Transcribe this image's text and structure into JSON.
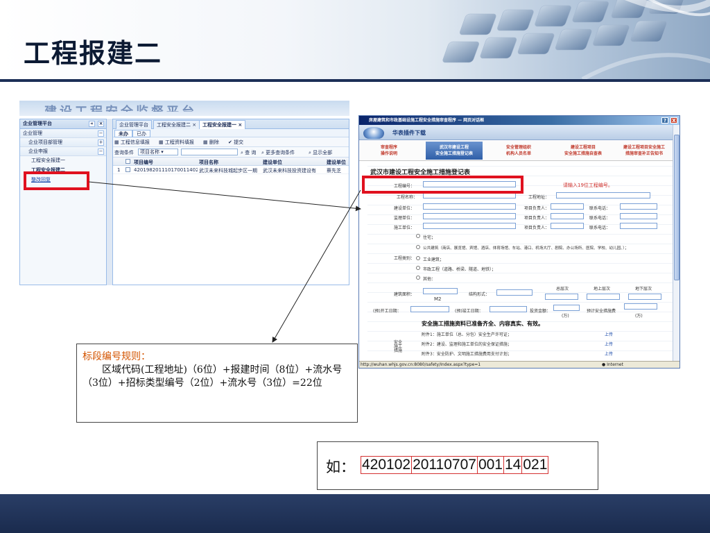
{
  "slide": {
    "title": "工程报建二",
    "colors": {
      "title": "#0c1a33",
      "header_rule": "#1c2f57",
      "footer": "#1f3257",
      "highlight": "#e0111f",
      "rule_title": "#d35400"
    }
  },
  "left_screenshot": {
    "banner_text": "建设工程安全监督平台",
    "sidebar": {
      "header": "企业管理平台",
      "header_buttons": [
        "«",
        "×"
      ],
      "rows": [
        {
          "label": "企业管理",
          "button": "−"
        },
        {
          "label": "企业项目部管理",
          "button": "+"
        },
        {
          "label": "企业申报",
          "button": "−"
        }
      ],
      "items": [
        "工程安全报建一",
        "工程安全报建二",
        "整改回复"
      ]
    },
    "tabs": [
      "企业管理平台",
      "工程安全报建二 ×",
      "工程安全报建一 ×"
    ],
    "subtabs": [
      "未办",
      "已办"
    ],
    "toolbar": [
      "工程信息填报",
      "工程资料填报",
      "删除",
      "提交"
    ],
    "query": {
      "label": "查询条件",
      "field": "项目名称",
      "buttons": [
        "查 询",
        "更多查询条件",
        "显示全部"
      ]
    },
    "grid": {
      "columns": [
        "项目编号",
        "项目名称",
        "建设单位",
        "建设单位"
      ],
      "row": {
        "index": "1",
        "project_no": "4201982011101700114021",
        "project_name": "武汉未来科技城起步区一期",
        "builder": "武汉未来科技投资建设有",
        "extra": "蔡先芝"
      }
    }
  },
  "right_screenshot": {
    "window_title": "房屋建筑和市政基础设施工程安全措施审查程序 — 网页对话框",
    "window_buttons": [
      "?",
      "X"
    ],
    "plugin_label": "华表插件下载",
    "menu": [
      {
        "line1": "审查程序",
        "line2": "操作说明",
        "active": false
      },
      {
        "line1": "武汉市建设工程",
        "line2": "安全施工措施登记表",
        "active": true
      },
      {
        "line1": "安全管理组织",
        "line2": "机构人员名单",
        "active": false
      },
      {
        "line1": "建设工程项目",
        "line2": "安全施工措施自查表",
        "active": false
      },
      {
        "line1": "建设工程项目安全施工",
        "line2": "措施审查补正告知书",
        "active": false
      }
    ],
    "form": {
      "title": "武汉市建设工程安全施工措施登记表",
      "project_no_label": "工程编号：",
      "project_no_hint": "请输入19位工程编号。",
      "project_name_label": "工程名称：",
      "project_address_label": "工程地址：",
      "rows": [
        {
          "unit": "建设单位：",
          "person": "项目负责人：",
          "phone": "联系电话："
        },
        {
          "unit": "监理单位：",
          "person": "项目负责人：",
          "phone": "联系电话："
        },
        {
          "unit": "施工单位：",
          "person": "项目负责人：",
          "phone": "联系电话："
        }
      ],
      "category_label": "工程类别：",
      "categories": [
        "住宅；",
        "公共建筑（商店、展览馆、宾馆、酒店、体育场馆、车站、港口、机场大厅、剧院、办公场所、医院、学校、幼儿园、）；",
        "工业建筑；",
        "市政工程（道路、桥梁、隧道、地铁）；",
        "其他："
      ],
      "area_label": "建筑面积：",
      "area_unit": "M2",
      "structure_label": "结构形式：",
      "floors": [
        "总层次",
        "地上层次",
        "地下层次"
      ],
      "start_label": "(预)开工日期：",
      "end_label": "(预)竣工日期：",
      "invest_label": "投资金额：",
      "invest_unit": "(万)",
      "safety_fee_label": "预计安全措施费",
      "safety_fee_unit": "(万)",
      "docs_title": "安全施工措施资料已准备齐全、内容真实、有效。",
      "docs_side": "安全\n施工\n措施",
      "attachments": [
        "附件1：施工单位（总、分包）安全生产许可证；",
        "附件2：建设、监理和施工单位的安全保证措施；",
        "附件3：安全防护、文明施工措施费用支付计划；"
      ],
      "upload": "上传"
    },
    "status_url": "http://wuhan.whjs.gov.cn:8080/safety/Index.aspx?type=1",
    "status_zone": "Internet"
  },
  "rule": {
    "title": "标段编号规则：",
    "body": "区域代码(工程地址)（6位）+报建时间（8位）+流水号（3位）+招标类型编号（2位）+流水号（3位）=22位"
  },
  "example": {
    "prefix": "如：",
    "segments": [
      "420102",
      "20110707",
      "001",
      "14",
      "021"
    ]
  }
}
